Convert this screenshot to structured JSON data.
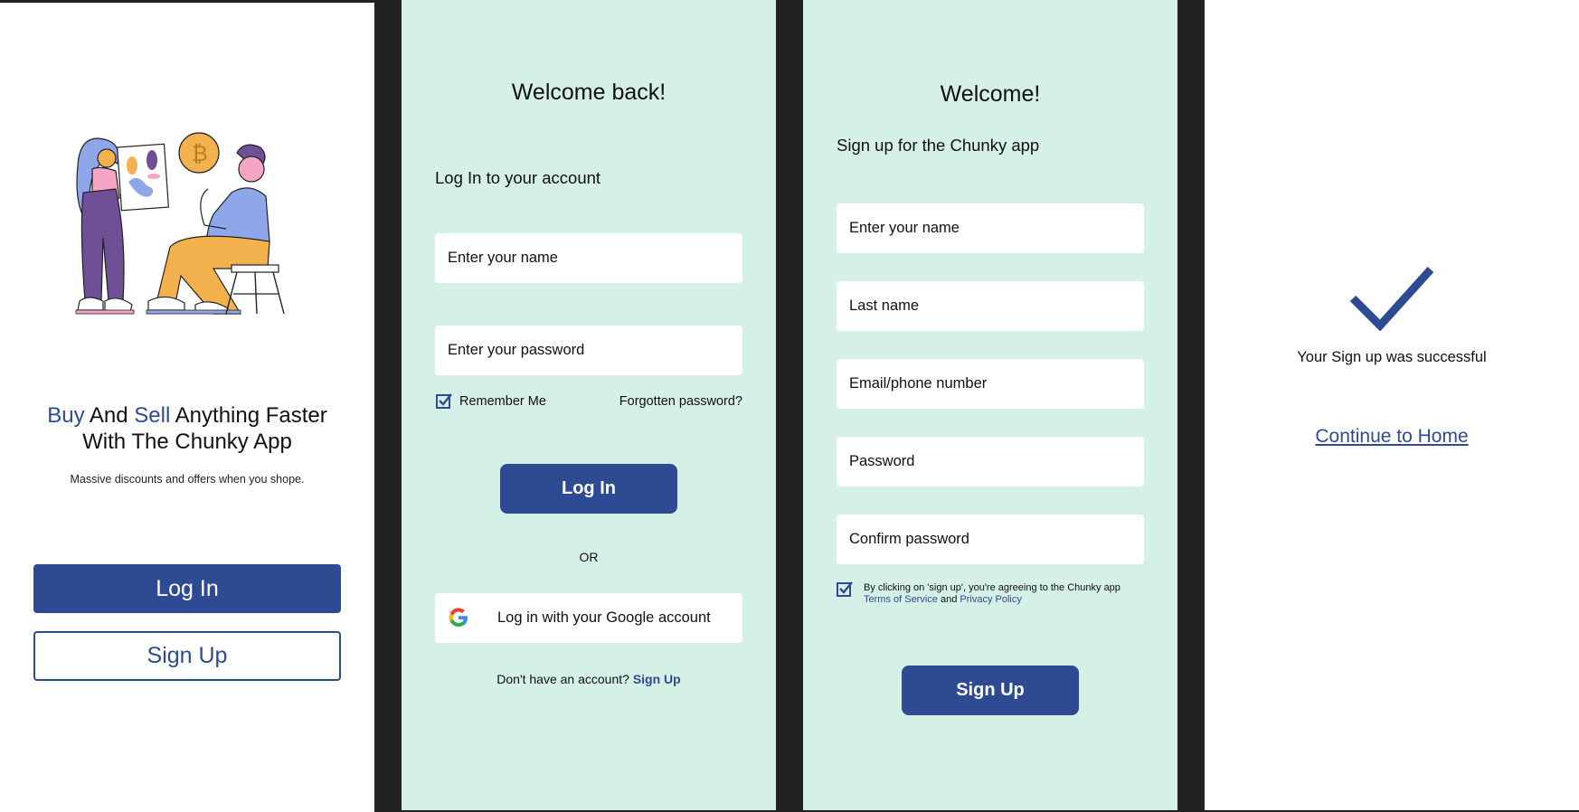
{
  "onboarding": {
    "headline_buy": "Buy",
    "headline_and": "And",
    "headline_sell": "Sell",
    "headline_rest": "Anything Faster",
    "headline_line2": "With The Chunky App",
    "subline": "Massive discounts and offers when you shope.",
    "login_label": "Log In",
    "signup_label": "Sign Up",
    "illustration": "people-trading-illustration"
  },
  "login": {
    "title": "Welcome back!",
    "subtitle": "Log In to your account",
    "name_placeholder": "Enter your name",
    "password_placeholder": "Enter your password",
    "remember_label": "Remember Me",
    "remember_checked": true,
    "forgot_label": "Forgotten password?",
    "login_label": "Log In",
    "or_label": "OR",
    "google_label": "Log in with your Google account",
    "no_account_text": "Don't have an account?",
    "signup_link": "Sign Up"
  },
  "signup": {
    "title": "Welcome!",
    "subtitle": "Sign up for the Chunky app",
    "fields": [
      "Enter your name",
      "Last name",
      "Email/phone number",
      "Password",
      "Confirm password"
    ],
    "terms_prefix": "By clicking on 'sign up', you're agreeing to the Chunky app",
    "terms_link": "Terms of Service",
    "terms_and": "and",
    "privacy_link": "Privacy Policy",
    "terms_checked": true,
    "signup_label": "Sign Up"
  },
  "success": {
    "message": "Your Sign up was successful",
    "continue_label": "Continue to Home",
    "icon": "checkmark-icon"
  },
  "colors": {
    "brand": "#2e4a93",
    "mint": "#d5f0e7",
    "divider": "#222222"
  }
}
